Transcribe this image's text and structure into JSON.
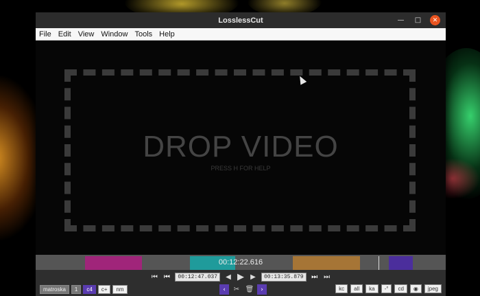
{
  "window": {
    "title": "LosslessCut",
    "controls": [
      "minimize-icon",
      "maximize-icon",
      "close-icon"
    ]
  },
  "menu": [
    "File",
    "Edit",
    "View",
    "Window",
    "Tools",
    "Help"
  ],
  "drop": {
    "title": "DROP VIDEO",
    "subtitle": "PRESS H FOR HELP"
  },
  "timeline": {
    "current_time": "00:12:22.616",
    "segment_colors": [
      "#a0257a",
      "#1f9b9b",
      "#a67536",
      "#4b2e9c"
    ]
  },
  "playback": {
    "start_time": "00:12:47.037",
    "end_time": "00:13:35.879"
  },
  "bottom_left": {
    "format": "matroska",
    "badge": "1",
    "toggles": [
      "c4",
      "c+",
      "nm"
    ]
  },
  "bottom_right": [
    "kc",
    "all",
    "ka",
    "-°",
    "cd",
    "jpeg"
  ]
}
